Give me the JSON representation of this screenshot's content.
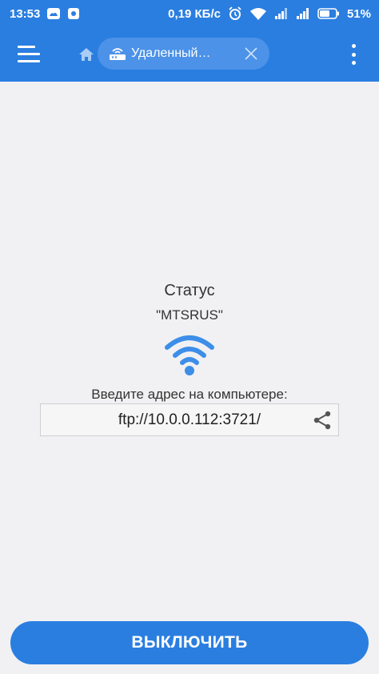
{
  "status_bar": {
    "time": "13:53",
    "network_speed": "0,19 КБ/с",
    "battery": "51%",
    "icons": [
      "weather-icon",
      "app-notification-icon",
      "alarm-icon",
      "wifi-status-icon",
      "signal-icon",
      "signal-icon-2",
      "battery-icon"
    ]
  },
  "app_bar": {
    "tab_label": "Удаленный…",
    "icons": [
      "menu-icon",
      "home-icon",
      "router-icon",
      "close-icon",
      "more-vert-icon"
    ]
  },
  "main": {
    "status_title": "Статус",
    "network_name": "\"MTSRUS\"",
    "address_label": "Введите адрес на компьютере:",
    "address": "ftp://10.0.0.112:3721/",
    "icons": [
      "wifi-icon",
      "share-icon"
    ]
  },
  "button": {
    "label": "ВЫКЛЮЧИТЬ"
  },
  "colors": {
    "primary": "#2a7ee0",
    "tab_chip": "#4b92e8",
    "background": "#f1f1f3",
    "wifi_icon": "#3d8ee8"
  }
}
